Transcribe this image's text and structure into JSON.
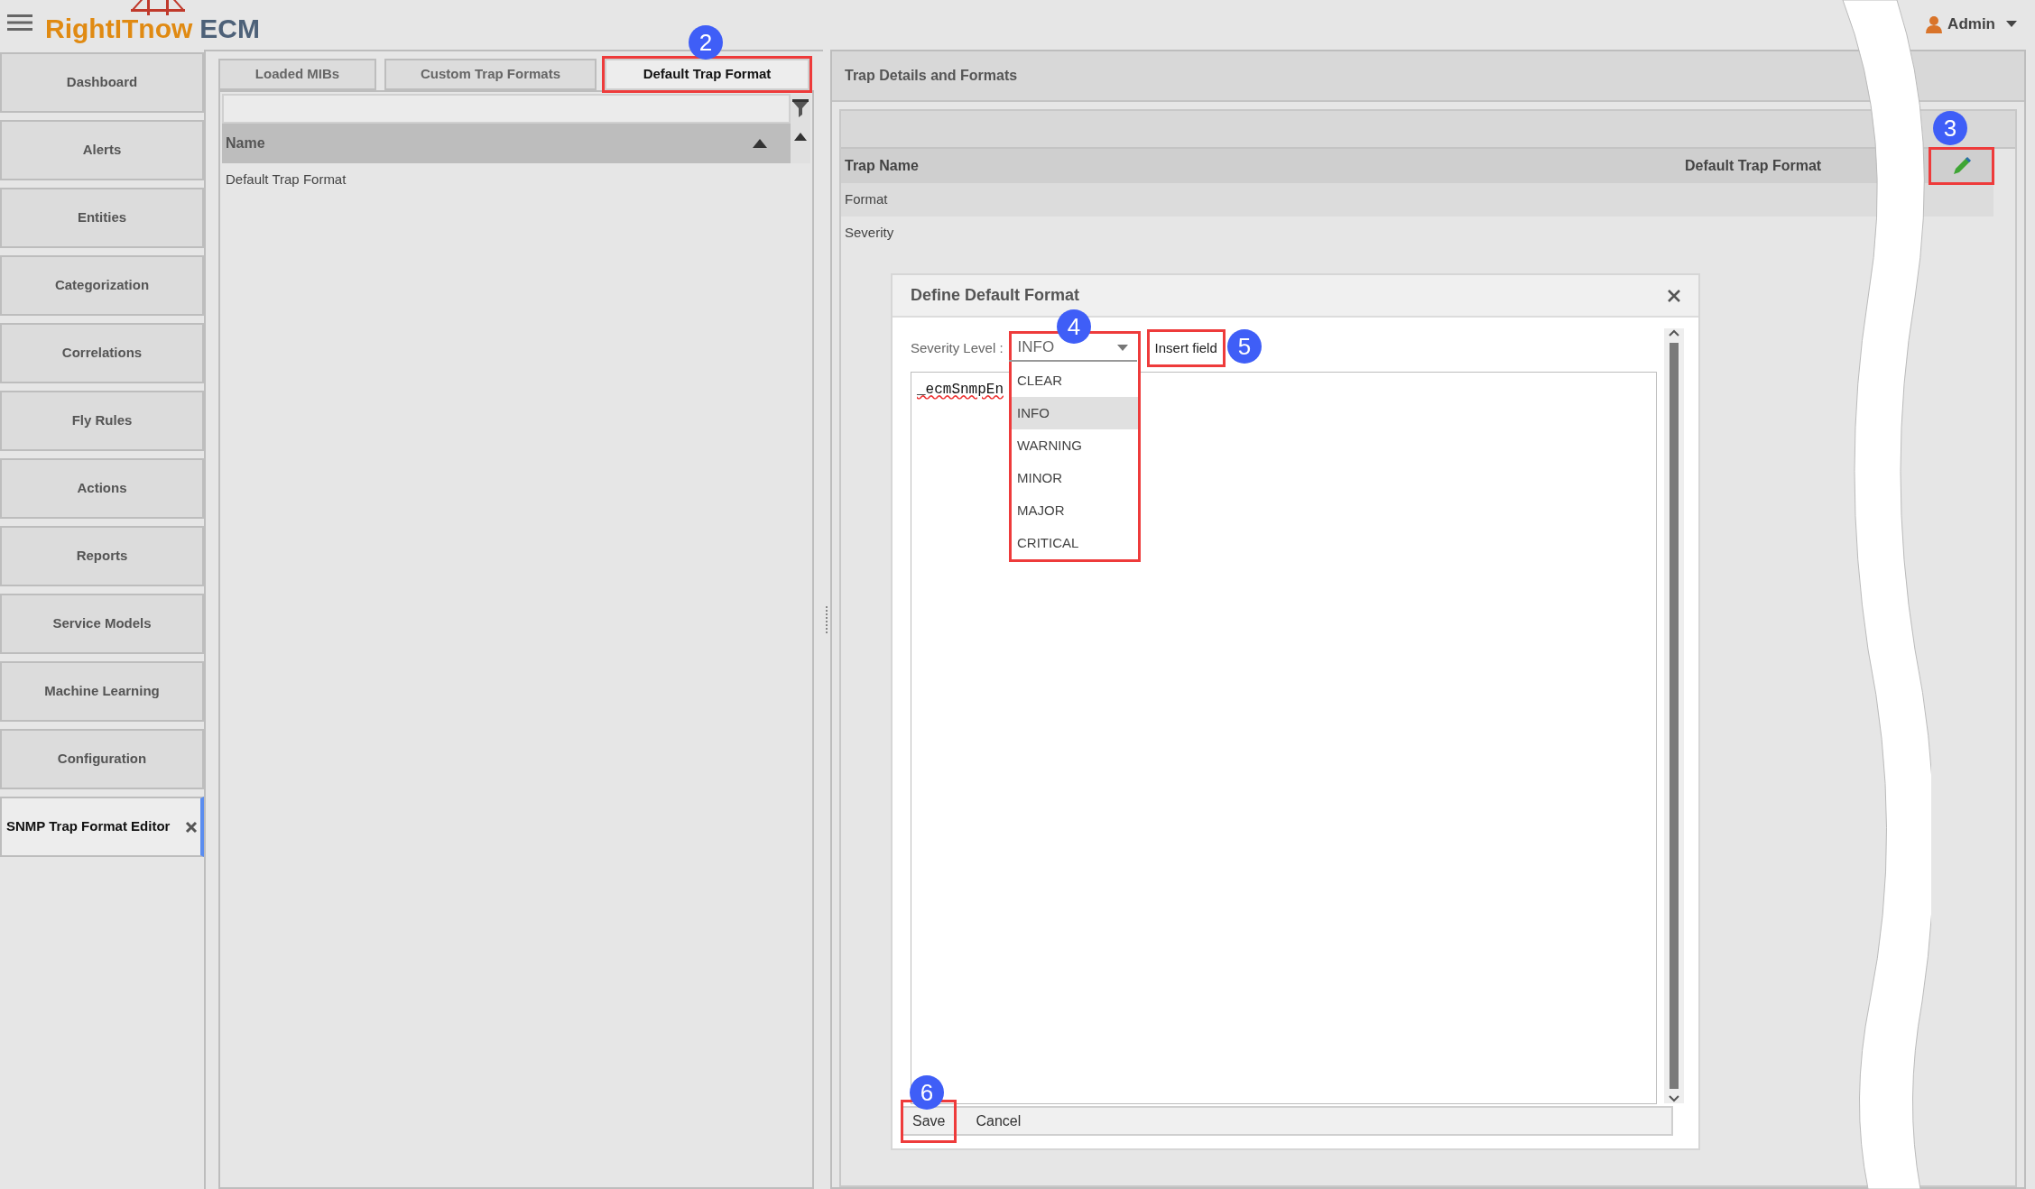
{
  "header": {
    "brand": "RightITnow",
    "product": "ECM",
    "user": "Admin"
  },
  "sidebar": {
    "items": [
      {
        "label": "Dashboard",
        "selected": false,
        "closable": false
      },
      {
        "label": "Alerts",
        "selected": false,
        "closable": false
      },
      {
        "label": "Entities",
        "selected": false,
        "closable": false
      },
      {
        "label": "Categorization",
        "selected": false,
        "closable": false
      },
      {
        "label": "Correlations",
        "selected": false,
        "closable": false
      },
      {
        "label": "Fly Rules",
        "selected": false,
        "closable": false
      },
      {
        "label": "Actions",
        "selected": false,
        "closable": false
      },
      {
        "label": "Reports",
        "selected": false,
        "closable": false
      },
      {
        "label": "Service Models",
        "selected": false,
        "closable": false
      },
      {
        "label": "Machine Learning",
        "selected": false,
        "closable": false
      },
      {
        "label": "Configuration",
        "selected": false,
        "closable": false
      },
      {
        "label": "SNMP Trap Format Editor",
        "selected": true,
        "closable": true
      }
    ]
  },
  "left_panel": {
    "tabs": [
      {
        "label": "Loaded MIBs",
        "selected": false,
        "highlighted": false
      },
      {
        "label": "Custom Trap Formats",
        "selected": false,
        "highlighted": false
      },
      {
        "label": "Default Trap Format",
        "selected": true,
        "highlighted": true,
        "callout": "2"
      }
    ],
    "column": "Name",
    "rows": [
      "Default Trap Format"
    ]
  },
  "right_panel": {
    "title": "Trap Details and Formats",
    "header": [
      "Trap Name",
      "Default Trap Format"
    ],
    "rows": [
      "Format",
      "Severity"
    ],
    "edit_button": {
      "highlighted": true,
      "callout": "3"
    }
  },
  "dialog": {
    "title": "Define Default Format",
    "severity_label": "Severity Level :",
    "severity": {
      "value": "INFO",
      "expanded": true,
      "highlighted": true,
      "callout": "4",
      "options": [
        {
          "label": "CLEAR",
          "selected": false
        },
        {
          "label": "INFO",
          "selected": true
        },
        {
          "label": "WARNING",
          "selected": false
        },
        {
          "label": "MINOR",
          "selected": false
        },
        {
          "label": "MAJOR",
          "selected": false
        },
        {
          "label": "CRITICAL",
          "selected": false
        }
      ]
    },
    "insert_field": {
      "label": "Insert field",
      "highlighted": true,
      "callout": "5"
    },
    "text": "_ecmSnmpEn",
    "buttons": [
      {
        "label": "Save",
        "highlighted": true,
        "callout": "6"
      },
      {
        "label": "Cancel",
        "highlighted": false
      }
    ]
  }
}
